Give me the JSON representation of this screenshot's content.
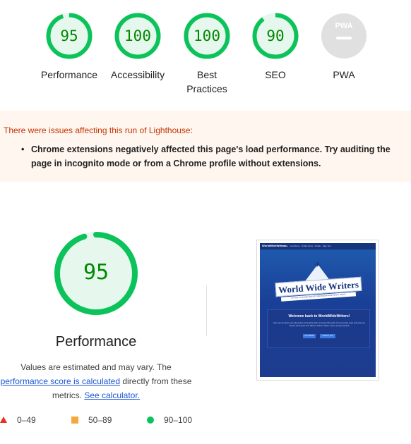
{
  "categories": [
    {
      "label": "Performance",
      "score": "95",
      "fraction": 0.95
    },
    {
      "label": "Accessibility",
      "score": "100",
      "fraction": 1.0
    },
    {
      "label": "Best Practices",
      "score": "100",
      "fraction": 1.0
    },
    {
      "label": "SEO",
      "score": "90",
      "fraction": 0.9
    },
    {
      "label": "PWA",
      "badge": "PWA"
    }
  ],
  "colors": {
    "pass": "#0bc35a",
    "pass_bg": "#e6f8ed",
    "pass_text": "#008800",
    "average": "#f4a93a",
    "fail": "#e8301f",
    "pwa_gray": "#e0e0e0"
  },
  "warning": {
    "title": "There were issues affecting this run of Lighthouse:",
    "items": [
      "Chrome extensions negatively affected this page's load performance. Try auditing the page in incognito mode or from a Chrome profile without extensions."
    ]
  },
  "main": {
    "score": "95",
    "fraction": 0.95,
    "title": "Performance",
    "desc_before": "Values are estimated and may vary. The",
    "desc_link": "performance score is calculated",
    "desc_after": " directly from these metrics. ",
    "calc_link": "See calculator."
  },
  "legend": [
    {
      "shape": "triangle",
      "range": "0–49"
    },
    {
      "shape": "square",
      "range": "50–89"
    },
    {
      "shape": "circle",
      "range": "90–100"
    }
  ],
  "thumbnail": {
    "brand": "WorldWideWriters",
    "nav": "Home · Contribute · Public Docs · Profile · Sign Out",
    "logo_text": "World Wide Writers",
    "tagline": "A PLACE TO SHARE AND GET NEW KNOWLEDGE ABOUT HACKS",
    "card_title": "Welcome back to WorldWideWriters!",
    "card_text": "Here you can share your adventures and explore others to expand the world. You can create posts and view your favorite travel posts from different authors. Share, travel, and get inspired!",
    "btn_primary": "Get Started",
    "btn_secondary": "Create a post"
  }
}
